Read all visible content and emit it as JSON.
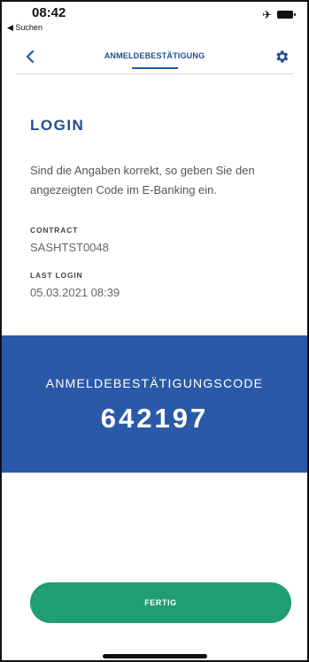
{
  "status_bar": {
    "time": "08:42",
    "back_app": "◀ Suchen",
    "icons": [
      "airplane-icon",
      "battery-icon"
    ]
  },
  "nav": {
    "title": "ANMELDEBESTÄTIGUNG",
    "back_icon": "chevron-left-icon",
    "settings_icon": "gear-icon"
  },
  "content": {
    "title": "LOGIN",
    "description": "Sind die Angaben korrekt, so geben Sie den angezeigten Code im E-Banking ein.",
    "contract_label": "CONTRACT",
    "contract_value": "SASHTST0048",
    "last_login_label": "LAST LOGIN",
    "last_login_value": "05.03.2021 08:39"
  },
  "code": {
    "label": "ANMELDEBESTÄTIGUNGSCODE",
    "value": "642197"
  },
  "actions": {
    "done_label": "FERTIG"
  },
  "colors": {
    "brand_blue": "#2a5aa7",
    "title_blue": "#1f4f8f",
    "button_green": "#1f9d74"
  }
}
